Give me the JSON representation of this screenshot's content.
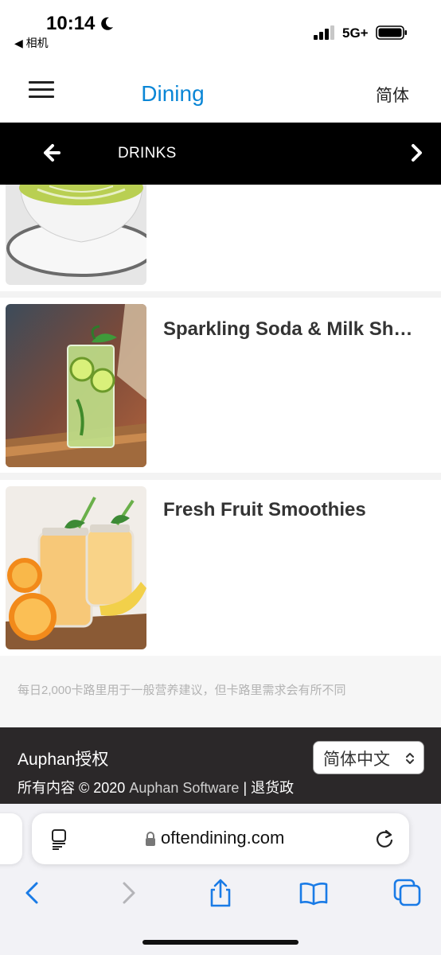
{
  "status_bar": {
    "time": "10:14",
    "back_app": "◀ 相机",
    "network": "5G+",
    "icons": [
      "moon-icon",
      "signal-icon",
      "battery-icon"
    ]
  },
  "header": {
    "title": "Dining",
    "language_link": "简体",
    "title_color": "#0a86d6"
  },
  "category_bar": {
    "label": "DRINKS",
    "background": "#000000"
  },
  "menu": {
    "items": [
      {
        "name": "",
        "image": "matcha-latte-image"
      },
      {
        "name": "Sparkling Soda & Milk Shakes",
        "image": "mojito-glass-image"
      },
      {
        "name": "Fresh Fruit Smoothies",
        "image": "smoothie-jars-image"
      }
    ]
  },
  "disclaimer": "每日2,000卡路里用于一般营养建议，但卡路里需求会有所不同",
  "footer": {
    "brand": "Auphan授权",
    "copyright_prefix": "所有内容 © 2020",
    "company": "Auphan Software",
    "separator": "|",
    "refund_link": "退货政",
    "language_select": "简体中文",
    "background": "#2b2829"
  },
  "browser": {
    "url": "oftendining.com"
  }
}
